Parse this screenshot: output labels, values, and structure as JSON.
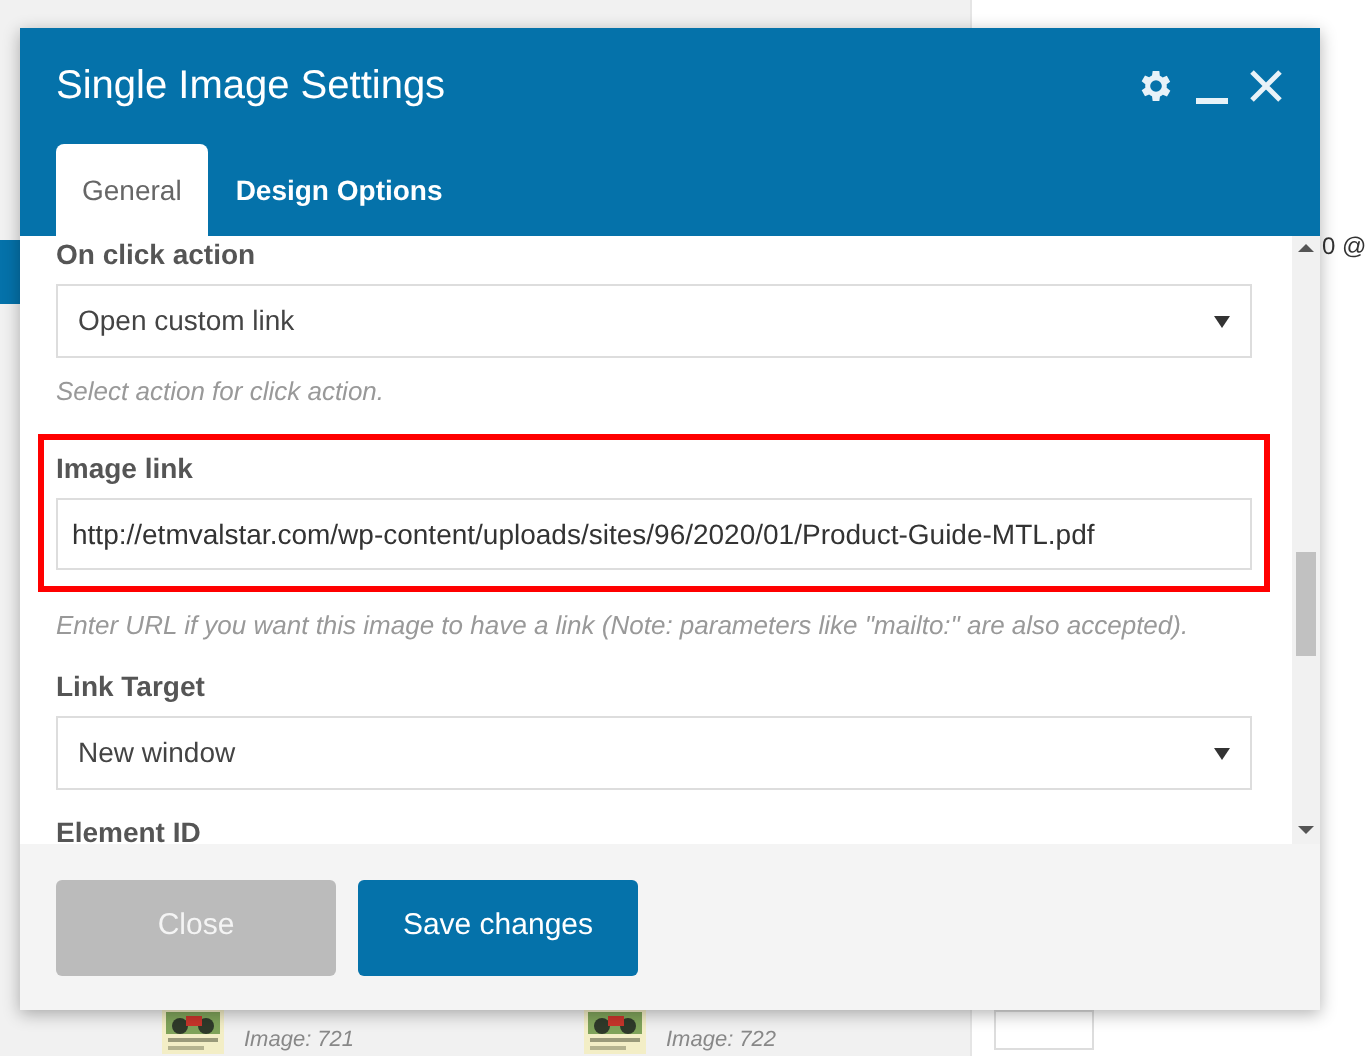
{
  "background": {
    "side_text": "0 @",
    "images": [
      {
        "caption": "Image: 721"
      },
      {
        "caption": "Image: 722"
      }
    ]
  },
  "dialog": {
    "title": "Single Image Settings",
    "tabs": [
      {
        "label": "General",
        "selected": true
      },
      {
        "label": "Design Options",
        "selected": false
      }
    ],
    "fields": [
      {
        "kind": "select",
        "label": "On click action",
        "value": "Open custom link",
        "hint": "Select action for click action.",
        "highlighted": false
      },
      {
        "kind": "text",
        "label": "Image link",
        "value": "http://etmvalstar.com/wp-content/uploads/sites/96/2020/01/Product-Guide-MTL.pdf",
        "hint": "Enter URL if you want this image to have a link (Note: parameters like \"mailto:\" are also accepted).",
        "highlighted": true
      },
      {
        "kind": "select",
        "label": "Link Target",
        "value": "New window",
        "highlighted": false
      },
      {
        "kind": "label",
        "label": "Element ID"
      }
    ],
    "buttons": [
      {
        "label": "Close",
        "kind": "secondary"
      },
      {
        "label": "Save changes",
        "kind": "primary"
      }
    ]
  }
}
